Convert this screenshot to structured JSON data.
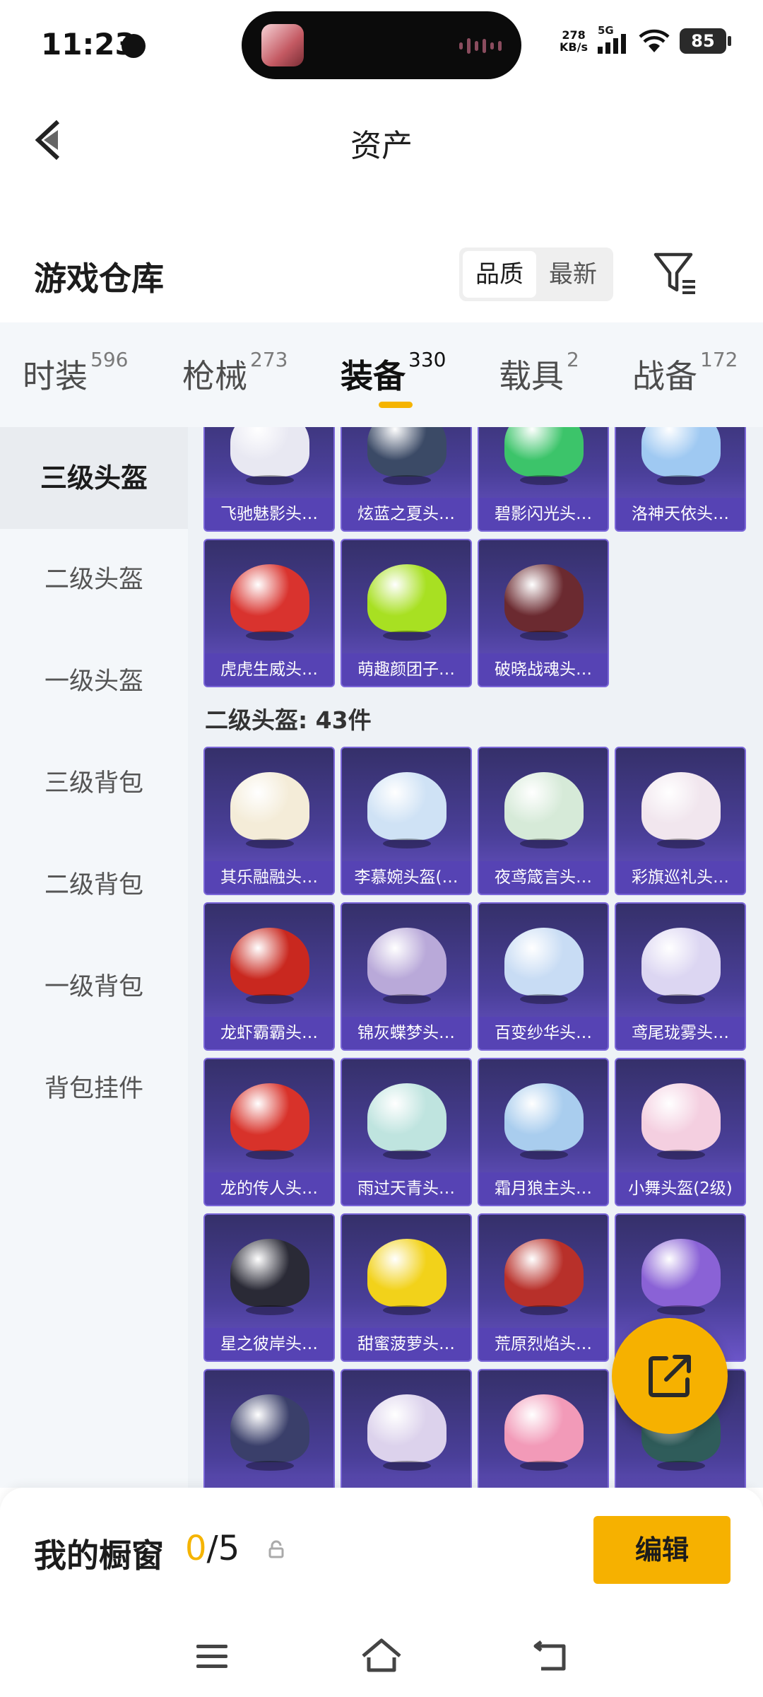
{
  "status_bar": {
    "time": "11:23",
    "net_speed_value": "278",
    "net_speed_unit": "KB/s",
    "signal_type": "5G",
    "battery": "85"
  },
  "header": {
    "title": "资产"
  },
  "warehouse": {
    "title": "游戏仓库",
    "sort_options": [
      "品质",
      "最新"
    ],
    "selected_sort": "品质"
  },
  "tabs": [
    {
      "label": "时装",
      "count": "596"
    },
    {
      "label": "枪械",
      "count": "273"
    },
    {
      "label": "装备",
      "count": "330",
      "active": true
    },
    {
      "label": "载具",
      "count": "2"
    },
    {
      "label": "战备",
      "count": "172"
    }
  ],
  "sidebar": [
    {
      "label": "三级头盔",
      "active": true
    },
    {
      "label": "二级头盔"
    },
    {
      "label": "一级头盔"
    },
    {
      "label": "三级背包"
    },
    {
      "label": "二级背包"
    },
    {
      "label": "一级背包"
    },
    {
      "label": "背包挂件"
    }
  ],
  "level3_items": [
    {
      "name": "飞驰魅影头…",
      "color": "#e8e8f2"
    },
    {
      "name": "炫蓝之夏头…",
      "color": "#3b4a66"
    },
    {
      "name": "碧影闪光头…",
      "color": "#3cc46a"
    },
    {
      "name": "洛神天依头…",
      "color": "#9fc9f2"
    },
    {
      "name": "虎虎生威头…",
      "color": "#d9332e"
    },
    {
      "name": "萌趣颜团子…",
      "color": "#a8e022"
    },
    {
      "name": "破晓战魂头…",
      "color": "#6b2a30"
    }
  ],
  "section_level2": {
    "title": "二级头盔: 43件"
  },
  "level2_items": [
    {
      "name": "其乐融融头…",
      "color": "#f4ecd8"
    },
    {
      "name": "李慕婉头盔(…",
      "color": "#cfe2f5"
    },
    {
      "name": "夜鸢箴言头…",
      "color": "#d6ead8"
    },
    {
      "name": "彩旗巡礼头…",
      "color": "#f1e6ee"
    },
    {
      "name": "龙虾霸霸头…",
      "color": "#c9281f"
    },
    {
      "name": "锦灰蝶梦头…",
      "color": "#b9a9d9"
    },
    {
      "name": "百变纱华头…",
      "color": "#c8dcf4"
    },
    {
      "name": "鸢尾珑雾头…",
      "color": "#dcd6f2"
    },
    {
      "name": "龙的传人头…",
      "color": "#d8322a"
    },
    {
      "name": "雨过天青头…",
      "color": "#bfe4df"
    },
    {
      "name": "霜月狼主头…",
      "color": "#a9cdee"
    },
    {
      "name": "小舞头盔(2级)",
      "color": "#f4cfe0"
    },
    {
      "name": "星之彼岸头…",
      "color": "#2a2a36"
    },
    {
      "name": "甜蜜菠萝头…",
      "color": "#f2d21a"
    },
    {
      "name": "荒原烈焰头…",
      "color": "#b8302a"
    },
    {
      "name": "",
      "color": "#8a62d6"
    },
    {
      "name": "",
      "color": "#3a3f6a"
    },
    {
      "name": "",
      "color": "#dcd2ec"
    },
    {
      "name": "",
      "color": "#f29ab8"
    },
    {
      "name": "",
      "color": "#2f5c5a"
    }
  ],
  "bottom": {
    "title": "我的橱窗",
    "current": "0",
    "max": "/5",
    "edit_label": "编辑"
  },
  "colors": {
    "accent": "#f6b100",
    "card_bg": "#4a3f99",
    "card_label_bg": "#5643b4"
  }
}
